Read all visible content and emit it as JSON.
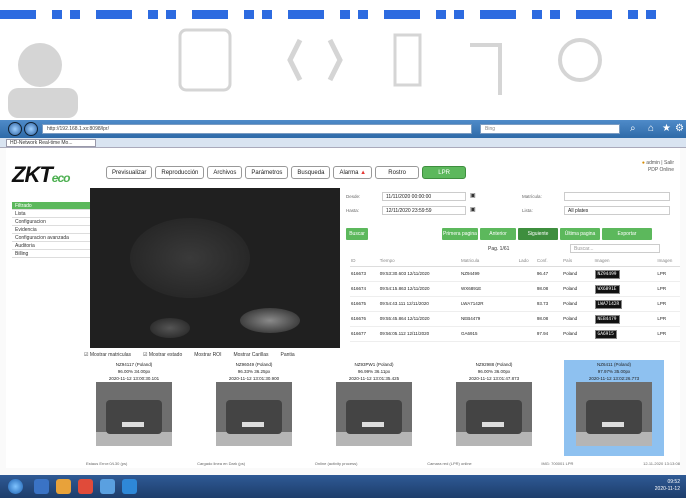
{
  "browser": {
    "address": "http://192.168.1.xx:8098/lpr/",
    "search_placeholder": "Bing",
    "tab_title": "HD-Network Real-time Mo..."
  },
  "app": {
    "logo_main": "ZKT",
    "logo_accent": "eco",
    "nav": [
      "Previsualizar",
      "Reproducción",
      "Archivos",
      "Parámetros",
      "Busqueda",
      "Alarma",
      "Rostro",
      "LPR"
    ],
    "user": "admin | Salir",
    "user_status": "PDP Online",
    "sidebar": [
      "Filtrado",
      "Lista",
      "Configuracion",
      "Evidencia",
      "Configuracion avanzada",
      "Auditoria",
      "Billing"
    ]
  },
  "form": {
    "desde_label": "Desde:",
    "desde_value": "11/11/2020 00:00:00",
    "hasta_label": "Hasta:",
    "hasta_value": "12/11/2020 23:59:59",
    "matricula_label": "Matrícula:",
    "lista_label": "Lista:",
    "lista_value": "All plates"
  },
  "buttons": {
    "buscar": "Buscar",
    "primera": "Primera pagina",
    "anterior": "Anterior",
    "siguiente": "Siguiente",
    "ultima": "Última pagina",
    "exportar": "Exportar"
  },
  "pager": {
    "page_text": "Pag. 1/61",
    "search_placeholder": "Buscar..."
  },
  "table": {
    "headers": [
      "ID",
      "Tiempo",
      "Matricula",
      "Lado",
      "Conf.",
      "País",
      "Imagen",
      "Imagen"
    ],
    "rows": [
      {
        "id": "616673",
        "time": "09:53:30.603 12/11/2020",
        "plate": "NZ94499",
        "conf": "96.47",
        "country": "Poland",
        "tag": "LPR"
      },
      {
        "id": "616674",
        "time": "09:54:15.863 12/11/2020",
        "plate": "WX6891E",
        "conf": "98.08",
        "country": "Poland",
        "tag": "LPR"
      },
      {
        "id": "616675",
        "time": "09:54:43.111 12/11/2020",
        "plate": "LWA7142R",
        "conf": "93.73",
        "country": "Poland",
        "tag": "LPR"
      },
      {
        "id": "616676",
        "time": "09:55:45.864 12/11/2020",
        "plate": "NEB4479",
        "conf": "98.08",
        "country": "Poland",
        "tag": "LPR"
      },
      {
        "id": "616677",
        "time": "09:56:05.112 12/11/2020",
        "plate": "GA6915",
        "conf": "97.94",
        "country": "Poland",
        "tag": "LPR"
      }
    ]
  },
  "checks": [
    "Mostrar matriculas",
    "Mostrar estado",
    "Mostrar ROI",
    "Mostrar Carillas",
    "Pantia"
  ],
  "thumbs": [
    {
      "plate": "NZ94117 (Poland)",
      "conf": "96.00% 34.00px",
      "time": "2020-11-12 13:00:30.101"
    },
    {
      "plate": "NZ96049 (Poland)",
      "conf": "96.33% 36.25px",
      "time": "2020-11-12 13:01:30.900"
    },
    {
      "plate": "NZ93PW1 (Poland)",
      "conf": "96.99% 36.11px",
      "time": "2020-11-12 13:01:35.425"
    },
    {
      "plate": "NZ92988 (Poland)",
      "conf": "96.00% 36.00px",
      "time": "2020-11-12 13:01:47.873"
    },
    {
      "plate": "NZ6411 (Poland)",
      "conf": "97.97% 35.00px",
      "time": "2020-11-12 13:02:26.773"
    }
  ],
  "status": [
    "Estaus Error:0/L30 (ps)",
    "Cargado linea en Dark (ps)",
    "Online (activity process)",
    "Camara red (LPR) online",
    "IMG: 700001 LPR",
    "12-11-2020 13:13:08"
  ],
  "taskbar": {
    "time": "09:52",
    "date": "2020-11-12"
  },
  "colors": {
    "accent": "#5cb85c",
    "banner_blue": "#2d6be0",
    "selected_thumb": "#8ec1f0"
  }
}
